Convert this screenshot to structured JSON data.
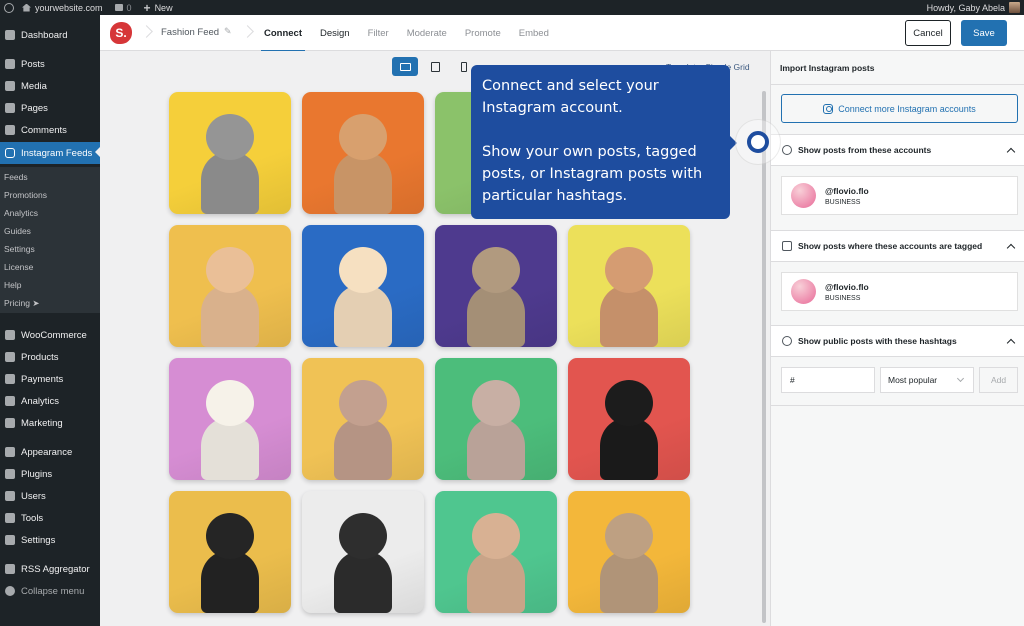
{
  "adminbar": {
    "site_name": "yourwebsite.com",
    "comments_count": "0",
    "new_label": "New",
    "greeting": "Howdy, Gaby Abela"
  },
  "sidebar": {
    "items": [
      {
        "label": "Dashboard",
        "icon": "dashboard-icon"
      },
      {
        "label": "Posts",
        "icon": "pin-icon"
      },
      {
        "label": "Media",
        "icon": "media-icon"
      },
      {
        "label": "Pages",
        "icon": "pages-icon"
      },
      {
        "label": "Comments",
        "icon": "comment-icon"
      },
      {
        "label": "Instagram Feeds",
        "icon": "instagram-icon",
        "active": true
      },
      {
        "label": "WooCommerce",
        "icon": "woocommerce-icon"
      },
      {
        "label": "Products",
        "icon": "products-icon"
      },
      {
        "label": "Payments",
        "icon": "payments-icon"
      },
      {
        "label": "Analytics",
        "icon": "analytics-icon"
      },
      {
        "label": "Marketing",
        "icon": "megaphone-icon"
      },
      {
        "label": "Appearance",
        "icon": "brush-icon"
      },
      {
        "label": "Plugins",
        "icon": "plugin-icon"
      },
      {
        "label": "Users",
        "icon": "user-icon"
      },
      {
        "label": "Tools",
        "icon": "wrench-icon"
      },
      {
        "label": "Settings",
        "icon": "settings-icon"
      },
      {
        "label": "RSS Aggregator",
        "icon": "rss-icon"
      },
      {
        "label": "Collapse menu",
        "icon": "collapse-icon"
      }
    ],
    "submenu": [
      "Feeds",
      "Promotions",
      "Analytics",
      "Guides",
      "Settings",
      "License",
      "Help",
      "Pricing ➤"
    ]
  },
  "topbar": {
    "logo_letter": "S.",
    "feed_name": "Fashion Feed",
    "tabs": [
      "Connect",
      "Design",
      "Filter",
      "Moderate",
      "Promote",
      "Embed"
    ],
    "active_tab": "Connect",
    "cancel_label": "Cancel",
    "save_label": "Save"
  },
  "preview": {
    "devices": [
      "desktop",
      "tablet",
      "mobile"
    ],
    "active_device": "desktop",
    "template_label": "Template: Simple Grid",
    "tiles": [
      {
        "bg": "#f5cf3a",
        "dog": "#8a8a8a",
        "desc": "schnauzer on yellow"
      },
      {
        "bg": "#e9772f",
        "dog": "#c89466",
        "desc": "corgi puppy on orange"
      },
      {
        "bg": "#8bc26a",
        "dog": "#8bc26a",
        "desc": "green tile"
      },
      {
        "bg": "#a6c982",
        "dog": "#a6c982",
        "desc": "hidden tile"
      },
      {
        "bg": "#efbf4e",
        "dog": "#d9b18c",
        "desc": "shih tzu in shirt on yellow"
      },
      {
        "bg": "#2a6bc4",
        "dog": "#e4cfb3",
        "desc": "fluffy dog on blue"
      },
      {
        "bg": "#4e3a8e",
        "dog": "#a48f76",
        "desc": "chihuahua on purple"
      },
      {
        "bg": "#ece05a",
        "dog": "#c5906a",
        "desc": "corgi puppy on yellow"
      },
      {
        "bg": "#d68dd3",
        "dog": "#e4e0d8",
        "desc": "retriever with goggles on pink"
      },
      {
        "bg": "#f0c255",
        "dog": "#b59484",
        "desc": "french bulldog on yellow"
      },
      {
        "bg": "#4cbd7b",
        "dog": "#b9a298",
        "desc": "french bulldog on green"
      },
      {
        "bg": "#e2554f",
        "dog": "#1a1a1a",
        "desc": "black dog on red"
      },
      {
        "bg": "#ebbd4c",
        "dog": "#222222",
        "desc": "french bulldog in chain on yellow"
      },
      {
        "bg": "#ececec",
        "dog": "#2b2b2b",
        "desc": "pug on white"
      },
      {
        "bg": "#4fc68f",
        "dog": "#c8a488",
        "desc": "french bulldog in jersey on green"
      },
      {
        "bg": "#f3b73a",
        "dog": "#b09478",
        "desc": "afghan hound on yellow"
      }
    ]
  },
  "tooltip": {
    "line1": "Connect and select your Instagram account.",
    "line2": "Show your own posts, tagged posts, or Instagram posts with particular hashtags."
  },
  "panel": {
    "title": "Import Instagram posts",
    "connect_label": "Connect more Instagram accounts",
    "sections": [
      {
        "label": "Show posts from these accounts",
        "icon": "user-circle-icon",
        "account": {
          "name": "@flovio.flo",
          "type": "BUSINESS"
        }
      },
      {
        "label": "Show posts where these accounts are tagged",
        "icon": "tagged-user-icon",
        "account": {
          "name": "@flovio.flo",
          "type": "BUSINESS"
        }
      },
      {
        "label": "Show public posts with these hashtags",
        "icon": "hashtag-icon"
      }
    ],
    "hashtag_value": "#",
    "sort_value": "Most popular",
    "add_label": "Add"
  },
  "colors": {
    "wp_dark": "#1d2327",
    "accent": "#2271b1",
    "tooltip": "#1e4d9f",
    "brand_red": "#d63638"
  }
}
